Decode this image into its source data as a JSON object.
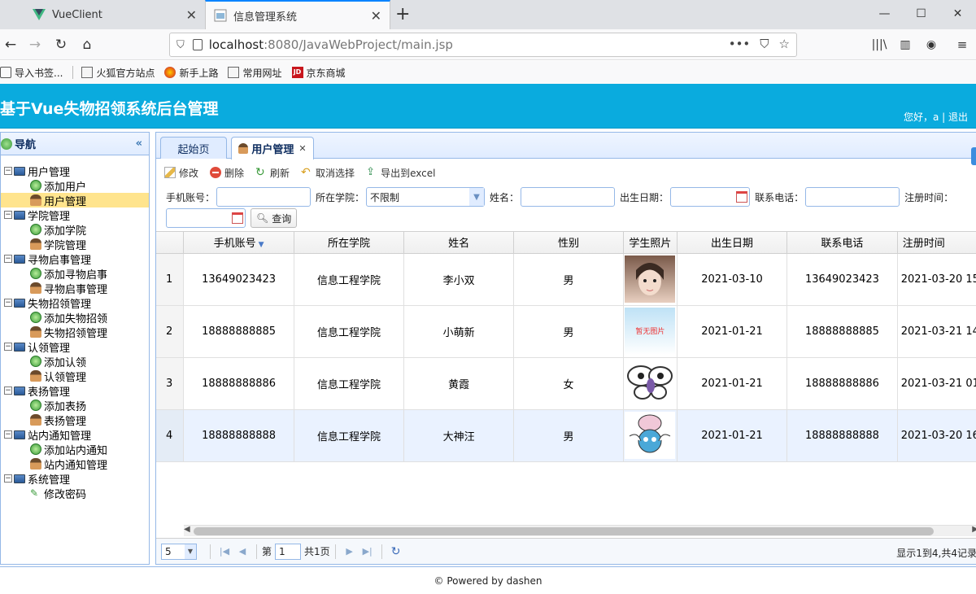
{
  "browser": {
    "tabs": [
      {
        "title": "VueClient",
        "icon": "vue-icon"
      },
      {
        "title": "信息管理系统",
        "icon": "page-icon"
      }
    ],
    "url_host": "localhost",
    "url_path": ":8080/JavaWebProject/main.jsp",
    "bookmarks": [
      "导入书签...",
      "火狐官方站点",
      "新手上路",
      "常用网址",
      "京东商城"
    ]
  },
  "app": {
    "title": "基于Vue失物招领系统后台管理",
    "greeting": "您好，a | 退出"
  },
  "sidebar": {
    "title": "导航",
    "groups": [
      {
        "label": "用户管理",
        "children": [
          "添加用户",
          "用户管理"
        ]
      },
      {
        "label": "学院管理",
        "children": [
          "添加学院",
          "学院管理"
        ]
      },
      {
        "label": "寻物启事管理",
        "children": [
          "添加寻物启事",
          "寻物启事管理"
        ]
      },
      {
        "label": "失物招领管理",
        "children": [
          "添加失物招领",
          "失物招领管理"
        ]
      },
      {
        "label": "认领管理",
        "children": [
          "添加认领",
          "认领管理"
        ]
      },
      {
        "label": "表扬管理",
        "children": [
          "添加表扬",
          "表扬管理"
        ]
      },
      {
        "label": "站内通知管理",
        "children": [
          "添加站内通知",
          "站内通知管理"
        ]
      },
      {
        "label": "系统管理",
        "children": [
          "修改密码"
        ]
      }
    ]
  },
  "tabs": [
    "起始页",
    "用户管理"
  ],
  "toolbar": [
    "修改",
    "删除",
    "刷新",
    "取消选择",
    "导出到excel"
  ],
  "search": {
    "phone_label": "手机账号：",
    "college_label": "所在学院：",
    "college_value": "不限制",
    "name_label": "姓名：",
    "birth_label": "出生日期：",
    "tel_label": "联系电话：",
    "reg_label": "注册时间：",
    "query_button": "查询"
  },
  "grid": {
    "columns": [
      "手机账号",
      "所在学院",
      "姓名",
      "性别",
      "学生照片",
      "出生日期",
      "联系电话",
      "注册时间"
    ],
    "rows": [
      {
        "n": "1",
        "phone": "13649023423",
        "college": "信息工程学院",
        "name": "李小双",
        "sex": "男",
        "photo": "girl",
        "birth": "2021-03-10",
        "tel": "13649023423",
        "reg": "2021-03-20 15"
      },
      {
        "n": "2",
        "phone": "18888888885",
        "college": "信息工程学院",
        "name": "小萌新",
        "sex": "男",
        "photo": "none",
        "photo_text": "暂无图片",
        "birth": "2021-01-21",
        "tel": "18888888885",
        "reg": "2021-03-21 14"
      },
      {
        "n": "3",
        "phone": "18888888886",
        "college": "信息工程学院",
        "name": "黄霞",
        "sex": "女",
        "photo": "butterfly",
        "birth": "2021-01-21",
        "tel": "18888888886",
        "reg": "2021-03-21 01"
      },
      {
        "n": "4",
        "phone": "18888888888",
        "college": "信息工程学院",
        "name": "大神汪",
        "sex": "男",
        "photo": "pokemon",
        "birth": "2021-01-21",
        "tel": "18888888888",
        "reg": "2021-03-20 16"
      }
    ]
  },
  "pager": {
    "page_size": "5",
    "page_prefix": "第",
    "page": "1",
    "page_total": "共1页",
    "info": "显示1到4,共4记录"
  },
  "footer": "© Powered by dashen"
}
